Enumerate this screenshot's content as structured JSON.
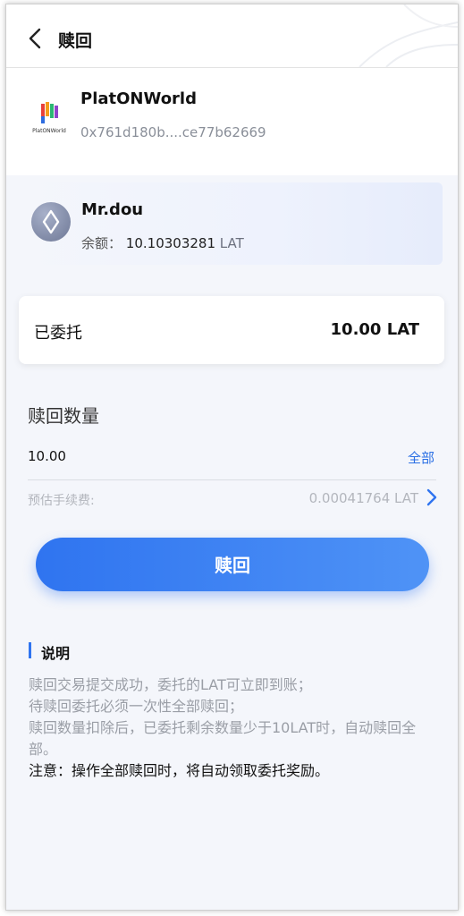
{
  "header": {
    "title": "赎回"
  },
  "node": {
    "name": "PlatONWorld",
    "address": "0x761d180b....ce77b62669",
    "logo_caption": "PlatONWorld"
  },
  "wallet": {
    "name": "Mr.dou",
    "balance_label": "余额：",
    "balance_value": "10.10303281",
    "balance_unit": "LAT"
  },
  "delegated": {
    "label": "已委托",
    "value": "10.00 LAT"
  },
  "redeem_form": {
    "section_title": "赎回数量",
    "amount_value": "10.00",
    "all_label": "全部",
    "fee_label": "预估手续费:",
    "fee_value": "0.00041764  LAT"
  },
  "submit": {
    "label": "赎回"
  },
  "notes": {
    "title": "说明",
    "lines": [
      "赎回交易提交成功，委托的LAT可立即到账；",
      "待赎回委托必须一次性全部赎回；",
      "赎回数量扣除后，已委托剩余数量少于10LAT时，自动赎回全部。"
    ],
    "warning": "注意：操作全部赎回时，将自动领取委托奖励。"
  },
  "colors": {
    "accent": "#2f74f0",
    "link": "#2a6fe4",
    "muted": "#9a9ea6"
  }
}
